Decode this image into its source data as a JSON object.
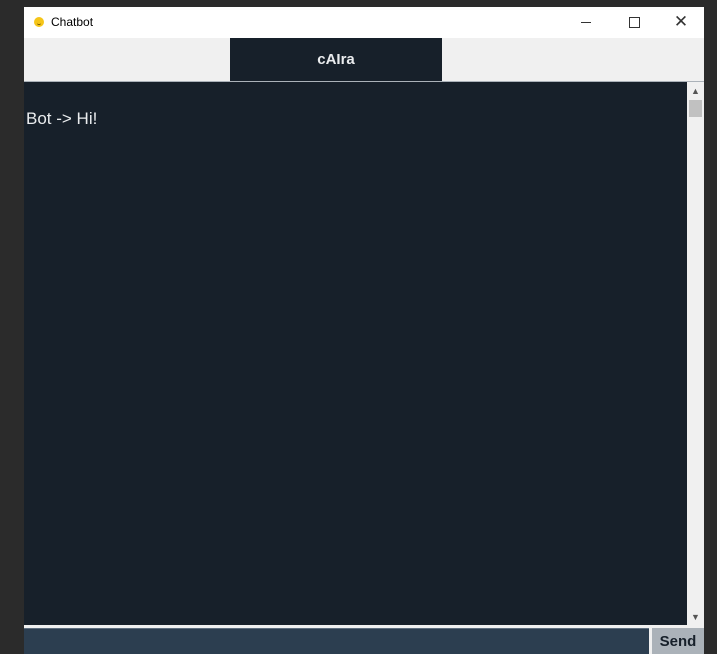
{
  "window": {
    "title": "Chatbot",
    "controls": {
      "minimize": "minimize",
      "maximize": "maximize",
      "close": "close"
    }
  },
  "header": {
    "label": "cAIra"
  },
  "chat": {
    "messages": [
      {
        "text": "Bot -> Hi!"
      }
    ]
  },
  "input": {
    "value": "",
    "send_label": "Send"
  },
  "colors": {
    "background": "#17202a",
    "text": "#eaecee",
    "entry": "#2c3e50",
    "send_button": "#abb2b9"
  },
  "icons": {
    "app": "smiley-icon",
    "scroll_up": "chevron-up-icon",
    "scroll_down": "chevron-down-icon"
  }
}
